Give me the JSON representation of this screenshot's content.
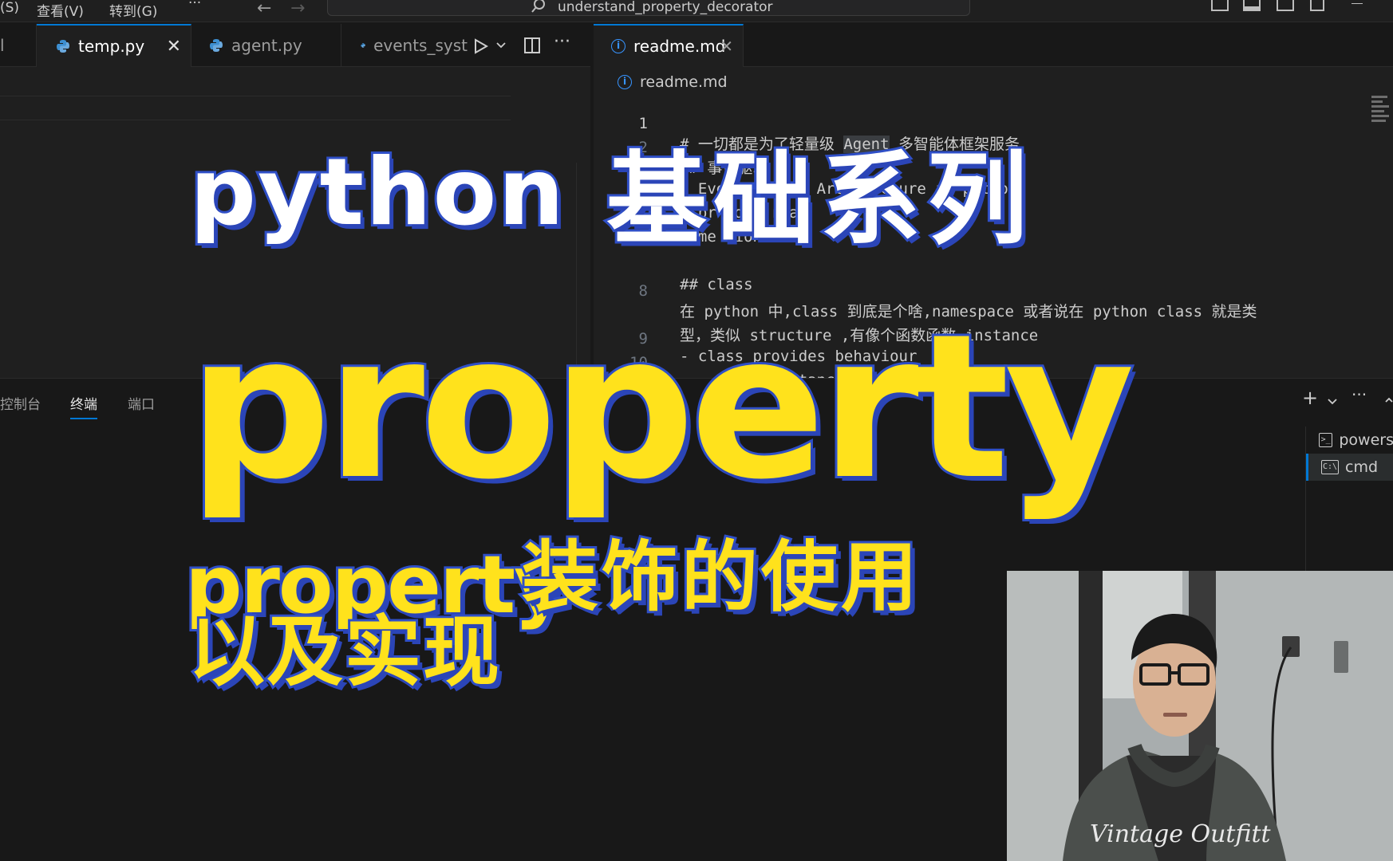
{
  "titlebar": {
    "menu": [
      "(S)",
      "查看(V)",
      "转到(G)",
      "···"
    ],
    "command_center_text": "understand_property_decorator"
  },
  "left_tabs": {
    "partial_edge": "l",
    "items": [
      {
        "label": "temp.py",
        "active": true
      },
      {
        "label": "agent.py",
        "active": false
      },
      {
        "label": "events_syst",
        "active": false
      }
    ]
  },
  "right_tabs": {
    "items": [
      {
        "label": "readme.md",
        "active": true
      }
    ]
  },
  "breadcrumb": {
    "file": "readme.md"
  },
  "code_lines": [
    {
      "num": "1",
      "pre": "# 一切都是为了轻量级 ",
      "hl": "Agent",
      "post": " 多智能体框架服务"
    },
    {
      "num": "2",
      "text": "## 事件驱动"
    },
    {
      "num": "",
      "text": "- Event-Drived Architecture in python"
    },
    {
      "num": "",
      "text": "- pr  de  reat"
    },
    {
      "num": "",
      "text": "- me  ion"
    },
    {
      "num": "",
      "text": ""
    },
    {
      "num": "",
      "text": "## class"
    },
    {
      "num": "8",
      "text": "在 python 中,class 到底是个啥,namespace 或者说在 python class 就是类"
    },
    {
      "num": "",
      "text": "型，类似 structure ,有像个函数函数,instance"
    },
    {
      "num": "9",
      "text": "- class provides behaviour"
    },
    {
      "num": "10",
      "text": "- ... ing instance(obeject)"
    }
  ],
  "panel": {
    "tabs": [
      {
        "label": "控制台",
        "active": false
      },
      {
        "label": "终端",
        "active": true
      },
      {
        "label": "端口",
        "active": false
      }
    ],
    "terminals": [
      {
        "label": "powers",
        "icon": ">_",
        "active": false
      },
      {
        "label": "cmd",
        "icon": "C:\\",
        "active": true
      }
    ]
  },
  "overlay": {
    "title_latin": "python",
    "title_cjk": "基础系列",
    "big": "property",
    "sub_latin": "property",
    "sub_cjk": "装饰的使用",
    "sub_line2": "以及实现"
  },
  "colors": {
    "accent": "#0078d4",
    "overlay_yellow": "#ffe21c",
    "overlay_blue": "#2f4fc7",
    "python_icon": "#3d8fd1"
  }
}
